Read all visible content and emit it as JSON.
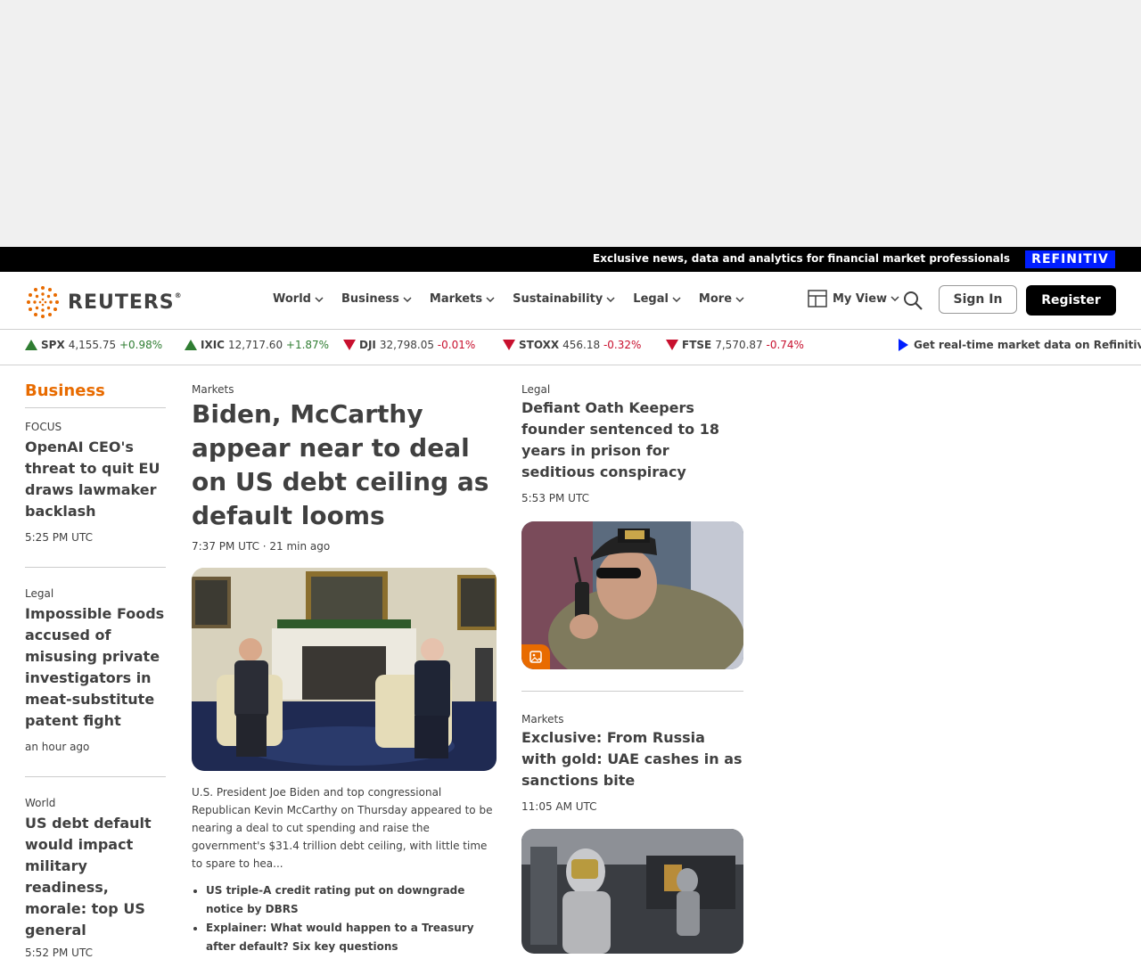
{
  "promo": {
    "text": "Exclusive news, data and analytics for financial market professionals",
    "brand": "REFINITIV"
  },
  "header": {
    "logo_text": "REUTERS",
    "logo_reg": "®",
    "nav": [
      "World",
      "Business",
      "Markets",
      "Sustainability",
      "Legal",
      "More"
    ],
    "myview": "My View",
    "signin": "Sign In",
    "register": "Register"
  },
  "ticker": {
    "items": [
      {
        "symbol": "SPX",
        "value": "4,155.75",
        "change": "+0.98%",
        "direction": "up"
      },
      {
        "symbol": "IXIC",
        "value": "12,717.60",
        "change": "+1.87%",
        "direction": "up"
      },
      {
        "symbol": "DJI",
        "value": "32,798.05",
        "change": "-0.01%",
        "direction": "down"
      },
      {
        "symbol": "STOXX",
        "value": "456.18",
        "change": "-0.32%",
        "direction": "down"
      },
      {
        "symbol": "FTSE",
        "value": "7,570.87",
        "change": "-0.74%",
        "direction": "down"
      }
    ],
    "cta": "Get real-time market data on Refinitiv"
  },
  "left": {
    "section": "Business",
    "stories": [
      {
        "kicker": "FOCUS",
        "headline": "OpenAI CEO's threat to quit EU draws lawmaker backlash",
        "time": "5:25 PM UTC"
      },
      {
        "kicker": "Legal",
        "headline": "Impossible Foods accused of misusing private investigators in meat-substitute patent fight",
        "time": "an hour ago"
      },
      {
        "kicker": "World",
        "headline": "US debt default would impact military readiness, morale: top US general",
        "time": "5:52 PM UTC"
      }
    ]
  },
  "lead": {
    "kicker": "Markets",
    "headline": "Biden, McCarthy appear near to deal on US debt ceiling as default looms",
    "time": "7:37 PM UTC · 21 min ago",
    "summary": "U.S. President Joe Biden and top congressional Republican Kevin McCarthy on Thursday appeared to be nearing a deal to cut spending and raise the government's $31.4 trillion debt ceiling, with little time to spare to hea...",
    "bullets": [
      "US triple-A credit rating put on downgrade notice by DBRS",
      "Explainer: What would happen to a Treasury after default? Six key questions"
    ]
  },
  "right": {
    "stories": [
      {
        "kicker": "Legal",
        "headline": "Defiant Oath Keepers founder sentenced to 18 years in prison for seditious conspiracy",
        "time": "5:53 PM UTC"
      },
      {
        "kicker": "Markets",
        "headline": "Exclusive: From Russia with gold: UAE cashes in as sanctions bite",
        "time": "11:05 AM UTC"
      }
    ]
  },
  "colors": {
    "accent": "#e86b00",
    "up": "#2f7d32",
    "down": "#c8102e",
    "refinitiv": "#001eff"
  }
}
